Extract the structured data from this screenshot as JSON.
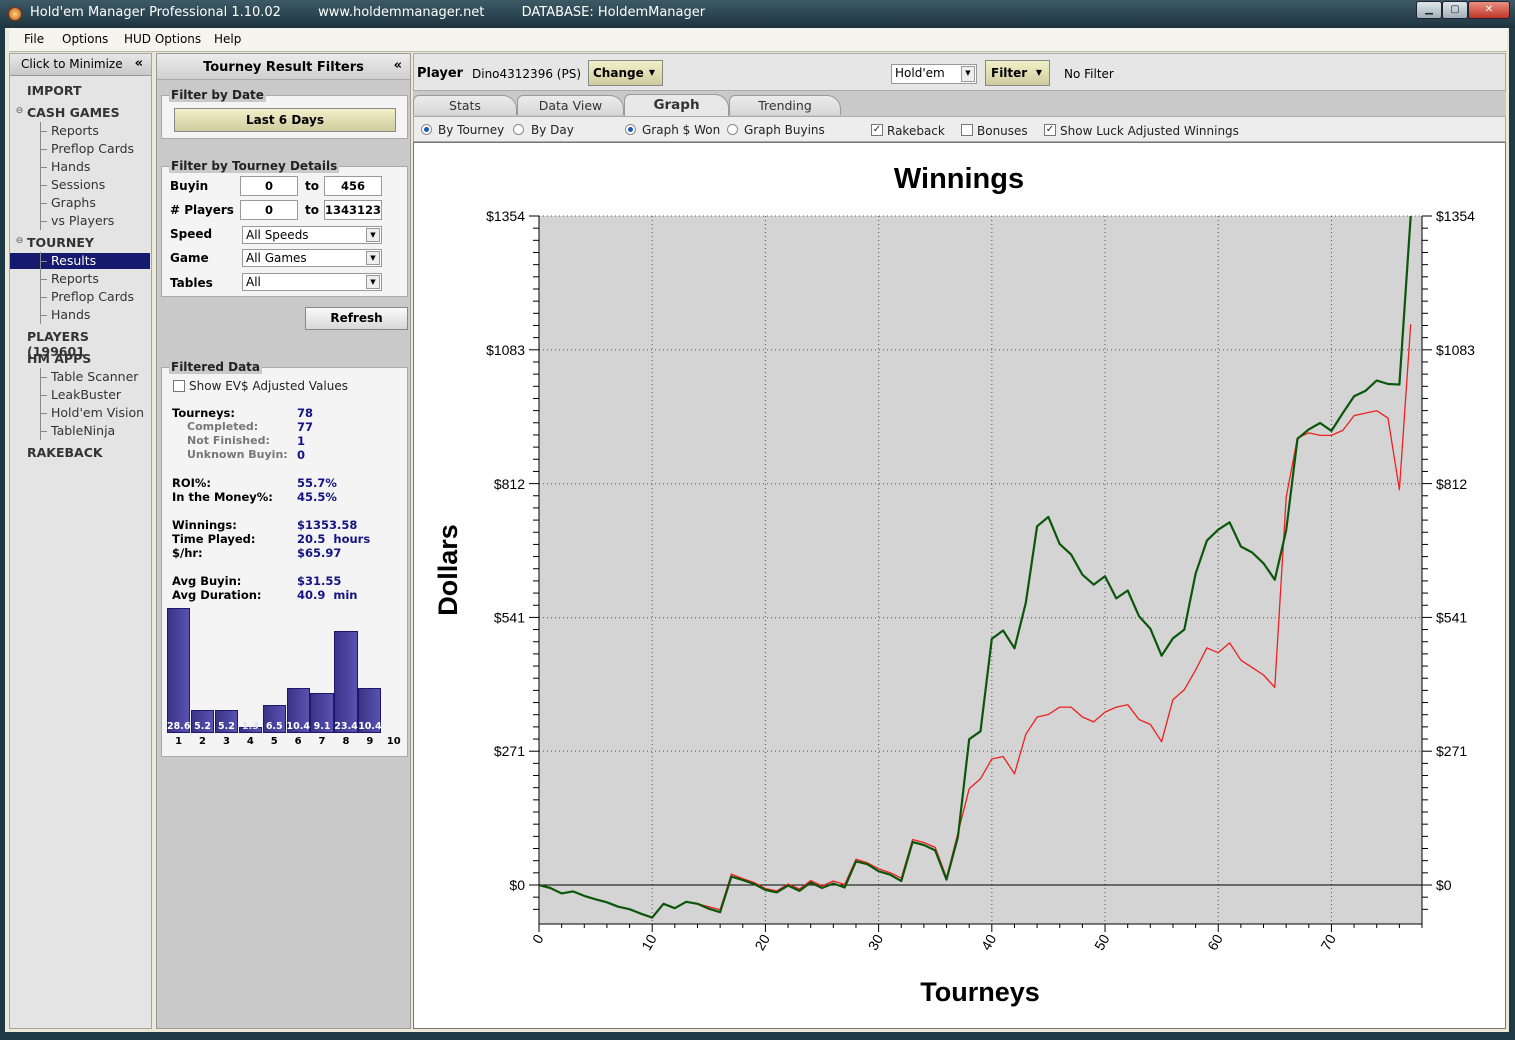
{
  "window": {
    "title": "Hold'em Manager Professional 1.10.02         www.holdemmanager.net         DATABASE: HoldemManager"
  },
  "menu": [
    "File",
    "Options",
    "HUD Options",
    "Help"
  ],
  "nav": {
    "minimize_label": "Click to Minimize",
    "minimize_arrow": "«",
    "import": "IMPORT",
    "cash_games": "CASH GAMES",
    "cash_items": [
      "Reports",
      "Preflop Cards",
      "Hands",
      "Sessions",
      "Graphs",
      "vs Players"
    ],
    "tourney": "TOURNEY",
    "tourney_items": [
      "Results",
      "Reports",
      "Preflop Cards",
      "Hands"
    ],
    "players": "PLAYERS (199601",
    "hm_apps": "HM APPS",
    "app_items": [
      "Table Scanner",
      "LeakBuster",
      "Hold'em Vision",
      "TableNinja"
    ],
    "rakeback": "RAKEBACK"
  },
  "filters": {
    "title": "Tourney Result Filters",
    "collapse_arrow": "«",
    "date_group": "Filter by Date",
    "date_button": "Last 6 Days",
    "details_group": "Filter by Tourney Details",
    "buyin_label": "Buyin",
    "buyin_from": "0",
    "buyin_to": "456",
    "to_label": "to",
    "players_label": "# Players",
    "players_from": "0",
    "players_to": "1343123",
    "speed_label": "Speed",
    "speed_value": "All Speeds",
    "game_label": "Game",
    "game_value": "All Games",
    "tables_label": "Tables",
    "tables_value": "All",
    "refresh": "Refresh"
  },
  "filtered": {
    "group": "Filtered Data",
    "ev_label": "Show EV$ Adjusted Values",
    "tourneys_l": "Tourneys:",
    "tourneys_v": "78",
    "completed_l": "Completed:",
    "completed_v": "77",
    "notfinished_l": "Not Finished:",
    "notfinished_v": "1",
    "unknown_l": "Unknown Buyin:",
    "unknown_v": "0",
    "roi_l": "ROI%:",
    "roi_v": "55.7%",
    "itm_l": "In the Money%:",
    "itm_v": "45.5%",
    "winnings_l": "Winnings:",
    "winnings_v": "$1353.58",
    "time_l": "Time Played:",
    "time_v": "20.5  hours",
    "hr_l": "$/hr:",
    "hr_v": "$65.97",
    "avgbuyin_l": "Avg Buyin:",
    "avgbuyin_v": "$31.55",
    "avgdur_l": "Avg Duration:",
    "avgdur_v": "40.9  min",
    "finish_hist": {
      "values": [
        28.6,
        5.2,
        5.2,
        1.3,
        6.5,
        10.4,
        9.1,
        23.4,
        10.4,
        0
      ],
      "labels": [
        "28.6",
        "5.2",
        "5.2",
        "1.3",
        "6.5",
        "10.4",
        "9.1",
        "23.4",
        "10.4",
        ""
      ],
      "index": [
        "1",
        "2",
        "3",
        "4",
        "5",
        "6",
        "7",
        "8",
        "9",
        "10"
      ]
    }
  },
  "playerbar": {
    "player_label": "Player",
    "player_name": "Dino4312396 (PS)",
    "change": "Change",
    "game_select": "Hold'em",
    "filter": "Filter",
    "filter_status": "No Filter"
  },
  "tabs": [
    "Stats",
    "Data View",
    "Graph",
    "Trending"
  ],
  "options": {
    "by_tourney": "By Tourney",
    "by_day": "By Day",
    "graph_won": "Graph $ Won",
    "graph_buyins": "Graph Buyins",
    "rakeback": "Rakeback",
    "bonuses": "Bonuses",
    "luck": "Show Luck Adjusted Winnings"
  },
  "colors": {
    "won_line": "#0c560c",
    "luck_line": "#ee2020",
    "plot_bg": "#d4d4d4",
    "nav_selected": "#161a6e"
  },
  "chart_data": {
    "type": "line",
    "title": "Winnings",
    "xlabel": "Tourneys",
    "ylabel": "Dollars",
    "xlim": [
      0,
      78
    ],
    "ylim": [
      -70,
      1354
    ],
    "y_ticks": [
      0,
      271,
      541,
      812,
      1083,
      1354
    ],
    "y_tick_labels": [
      "$0",
      "$271",
      "$541",
      "$812",
      "$1083",
      "$1354"
    ],
    "x_ticks": [
      0,
      10,
      20,
      30,
      40,
      50,
      60,
      70
    ],
    "x_tick_labels": [
      "0",
      "10",
      "20",
      "30",
      "40",
      "50",
      "60",
      "70"
    ],
    "grid": true,
    "series": [
      {
        "color": "#0c560c",
        "x": [
          0,
          1,
          2,
          3,
          4,
          5,
          6,
          7,
          8,
          9,
          10,
          11,
          12,
          13,
          14,
          15,
          16,
          17,
          18,
          19,
          20,
          21,
          22,
          23,
          24,
          25,
          26,
          27,
          28,
          29,
          30,
          31,
          32,
          33,
          34,
          35,
          36,
          37,
          38,
          39,
          40,
          41,
          42,
          43,
          44,
          45,
          46,
          47,
          48,
          49,
          50,
          51,
          52,
          53,
          54,
          55,
          56,
          57,
          58,
          59,
          60,
          61,
          62,
          63,
          64,
          65,
          66,
          67,
          68,
          69,
          70,
          71,
          72,
          73,
          74,
          75,
          76,
          77
        ],
        "values": [
          0,
          -6,
          -17,
          -13,
          -22,
          -29,
          -35,
          -44,
          -49,
          -58,
          -66,
          -38,
          -47,
          -34,
          -38,
          -48,
          -55,
          17,
          10,
          2,
          -10,
          -15,
          -1,
          -12,
          5,
          -6,
          3,
          -5,
          48,
          42,
          28,
          21,
          8,
          87,
          81,
          70,
          11,
          97,
          295,
          311,
          498,
          515,
          479,
          571,
          726,
          745,
          690,
          669,
          628,
          608,
          625,
          580,
          596,
          544,
          519,
          464,
          499,
          517,
          630,
          697,
          719,
          734,
          685,
          673,
          651,
          618,
          718,
          903,
          922,
          935,
          919,
          955,
          989,
          1000,
          1021,
          1014,
          1013,
          1354
        ]
      },
      {
        "color": "#ee2020",
        "x": [
          0,
          1,
          2,
          3,
          4,
          5,
          6,
          7,
          8,
          9,
          10,
          11,
          12,
          13,
          14,
          15,
          16,
          17,
          18,
          19,
          20,
          21,
          22,
          23,
          24,
          25,
          26,
          27,
          28,
          29,
          30,
          31,
          32,
          33,
          34,
          35,
          36,
          37,
          38,
          39,
          40,
          41,
          42,
          43,
          44,
          45,
          46,
          47,
          48,
          49,
          50,
          51,
          52,
          53,
          54,
          55,
          56,
          57,
          58,
          59,
          60,
          61,
          62,
          63,
          64,
          65,
          66,
          67,
          68,
          69,
          70,
          71,
          72,
          73,
          74,
          75,
          76,
          77
        ],
        "values": [
          0,
          -6,
          -17,
          -13,
          -22,
          -29,
          -35,
          -44,
          -49,
          -58,
          -66,
          -38,
          -47,
          -34,
          -38,
          -44,
          -50,
          22,
          13,
          5,
          -7,
          -12,
          2,
          -8,
          9,
          -2,
          8,
          1,
          52,
          45,
          33,
          25,
          14,
          92,
          86,
          76,
          15,
          105,
          195,
          215,
          255,
          260,
          225,
          305,
          340,
          345,
          360,
          360,
          340,
          330,
          350,
          360,
          365,
          335,
          325,
          290,
          375,
          395,
          435,
          480,
          470,
          490,
          455,
          440,
          425,
          400,
          785,
          905,
          915,
          910,
          910,
          920,
          950,
          955,
          960,
          945,
          800,
          1135
        ]
      }
    ]
  }
}
